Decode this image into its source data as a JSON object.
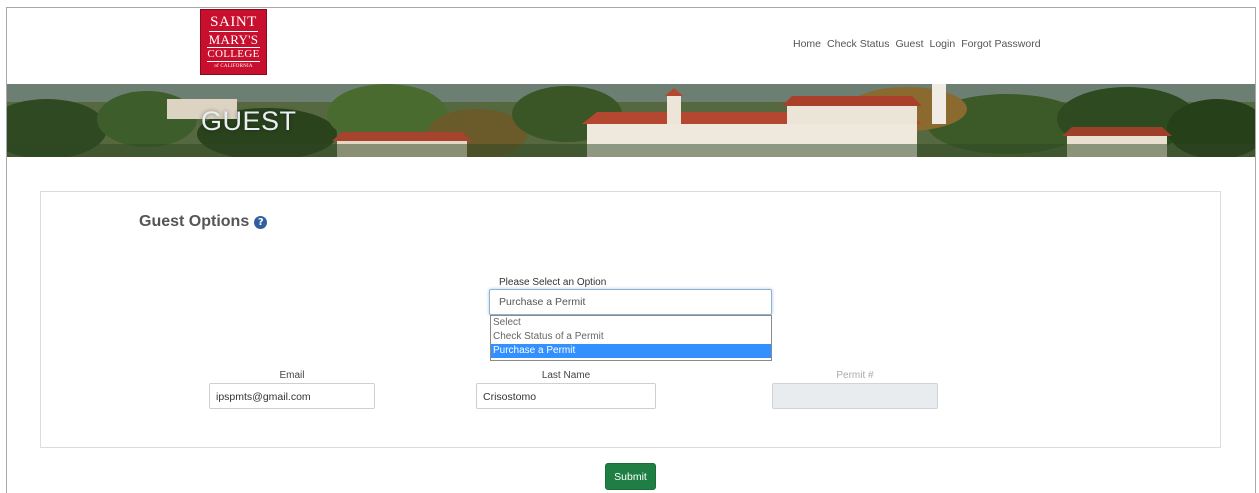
{
  "logo": {
    "line1": "SAINT",
    "line2": "MARY'S",
    "line3": "COLLEGE",
    "line4": "of CALIFORNIA"
  },
  "nav": {
    "items": [
      {
        "label": "Home"
      },
      {
        "label": "Check Status"
      },
      {
        "label": "Guest"
      },
      {
        "label": "Login"
      },
      {
        "label": "Forgot Password"
      }
    ]
  },
  "banner": {
    "title": "GUEST"
  },
  "guest_options": {
    "heading": "Guest Options",
    "help_icon": "question-circle-icon",
    "select_label": "Please Select an Option",
    "selected_value": "Purchase a Permit",
    "options": [
      {
        "label": "Select"
      },
      {
        "label": "Check Status of a Permit"
      },
      {
        "label": "Purchase a Permit"
      }
    ]
  },
  "form": {
    "email_label": "Email",
    "email_value": "ipspmts@gmail.com",
    "last_name_label": "Last Name",
    "last_name_value": "Crisostomo",
    "permit_label": "Permit #",
    "permit_value": ""
  },
  "submit_label": "Submit",
  "colors": {
    "brand_red": "#c8102e",
    "submit_green": "#1e7e44",
    "help_blue": "#2f5f9e",
    "selected_option": "#3390ff"
  }
}
